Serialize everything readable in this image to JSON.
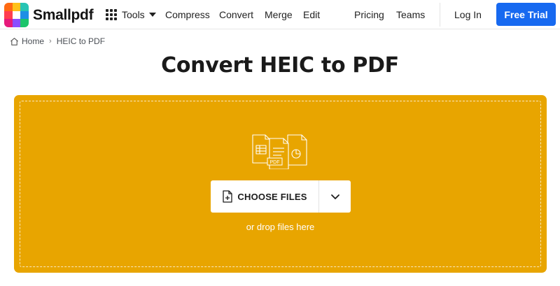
{
  "brand": {
    "name": "Smallpdf",
    "logo_colors": [
      "#ff6f00",
      "#ffc400",
      "#2ec4b6",
      "#ff3d57",
      "#ffffff",
      "#1e88e5",
      "#e91e63",
      "#7c4dff",
      "#00c853"
    ]
  },
  "nav": {
    "tools_label": "Tools",
    "compress_label": "Compress",
    "convert_label": "Convert",
    "merge_label": "Merge",
    "edit_label": "Edit",
    "pricing_label": "Pricing",
    "teams_label": "Teams",
    "login_label": "Log In",
    "trial_label": "Free Trial"
  },
  "breadcrumb": {
    "home_label": "Home",
    "separator": "›",
    "current_label": "HEIC to PDF"
  },
  "page": {
    "title": "Convert HEIC to PDF"
  },
  "dropzone": {
    "choose_label": "CHOOSE FILES",
    "hint": "or drop files here",
    "badge_label": "PDF",
    "bg_color": "#e8a500"
  },
  "colors": {
    "accent": "#1769f0"
  }
}
